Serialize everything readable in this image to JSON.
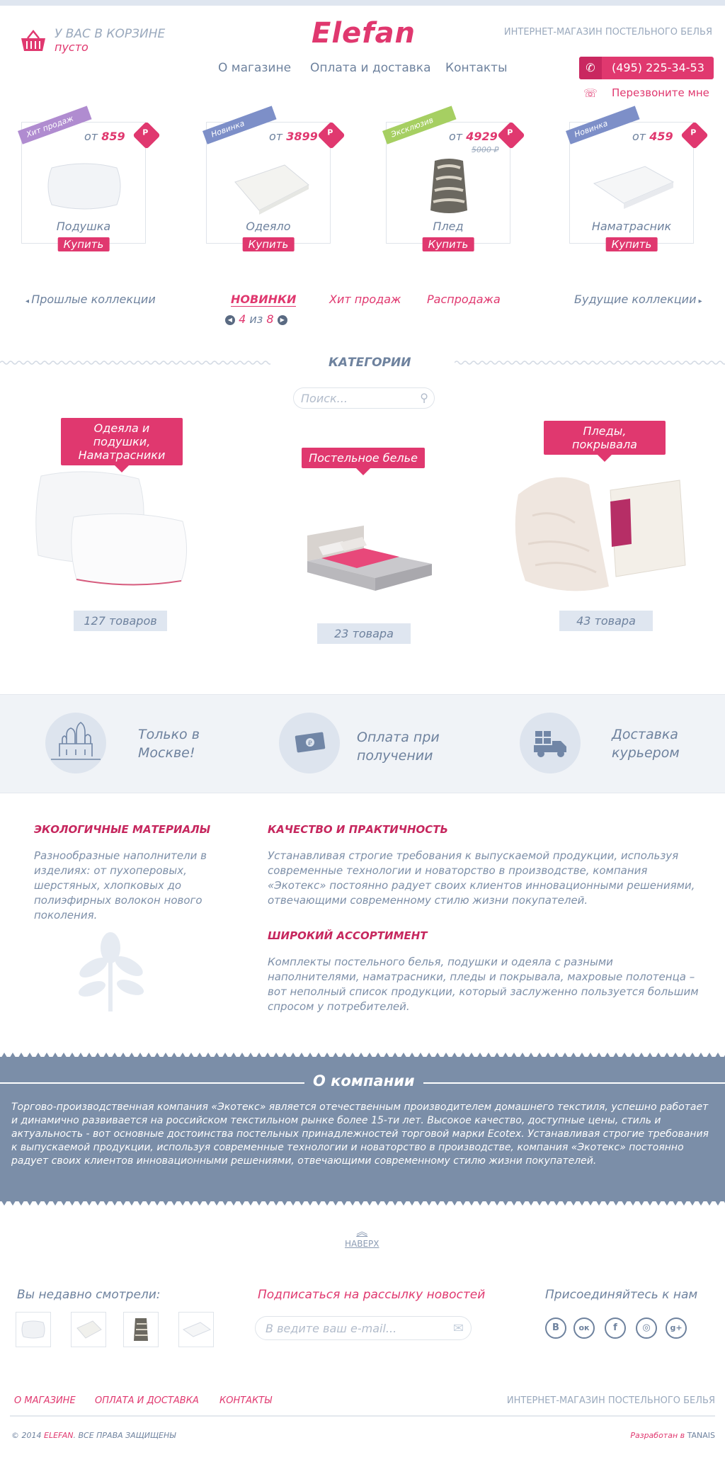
{
  "header": {
    "cart_line1": "У ВАС В КОРЗИНЕ",
    "cart_line2": "пусто",
    "logo": "Elefan",
    "tagline": "ИНТЕРНЕТ-МАГАЗИН ПОСТЕЛЬНОГО БЕЛЬЯ",
    "nav": [
      "О магазине",
      "Оплата и доставка",
      "Контакты"
    ],
    "phone": "(495) 225-34-53",
    "callback": "Перезвоните мне"
  },
  "products": [
    {
      "ribbon": "Хит продаж",
      "ribbon_color": "#b08cd0",
      "price_prefix": "от",
      "price": "859",
      "old_price": "",
      "currency": "Р",
      "name": "Подушка",
      "buy": "Купить"
    },
    {
      "ribbon": "Новинка",
      "ribbon_color": "#7d8fc8",
      "price_prefix": "от",
      "price": "3899",
      "old_price": "",
      "currency": "Р",
      "name": "Одеяло",
      "buy": "Купить"
    },
    {
      "ribbon": "Эксклюзив",
      "ribbon_color": "#a6cf62",
      "price_prefix": "от",
      "price": "4929",
      "old_price": "5000 ₽",
      "currency": "Р",
      "name": "Плед",
      "buy": "Купить"
    },
    {
      "ribbon": "Новинка",
      "ribbon_color": "#7d8fc8",
      "price_prefix": "от",
      "price": "459",
      "old_price": "",
      "currency": "Р",
      "name": "Наматрасник",
      "buy": "Купить"
    }
  ],
  "collections": {
    "prev": "Прошлые коллекции",
    "next": "Будущие коллекции",
    "tabs": [
      "НОВИНКИ",
      "Хит продаж",
      "Распродажа"
    ],
    "pager_current": "4",
    "pager_sep": "из",
    "pager_total": "8"
  },
  "categories": {
    "title": "КАТЕГОРИИ",
    "search_placeholder": "Поиск...",
    "items": [
      {
        "label": "Одеяла и подушки, Наматрасники",
        "count": "127 товаров"
      },
      {
        "label": "Постельное белье",
        "count": "23 товара"
      },
      {
        "label": "Пледы, покрывала",
        "count": "43 товара"
      }
    ]
  },
  "features": [
    {
      "text": "Только в Москве!",
      "icon": "kremlin-icon"
    },
    {
      "text": "Оплата при получении",
      "icon": "money-icon"
    },
    {
      "text": "Доставка курьером",
      "icon": "truck-icon"
    }
  ],
  "info": {
    "eco_title": "ЭКОЛОГИЧНЫЕ МАТЕРИАЛЫ",
    "eco_text": "Разнообразные наполнители в изделиях: от пухоперовых, шерстяных, хлопковых до полиэфирных волокон нового поколения.",
    "quality_title": "КАЧЕСТВО И ПРАКТИЧНОСТЬ",
    "quality_text": "Устанавливая строгие требования к выпускаемой продукции, используя современные технологии и новаторство в производстве, компания «Экотекс» постоянно радует своих клиентов инновационными решениями, отвечающими современному стилю жизни покупателей.",
    "range_title": "ШИРОКИЙ АССОРТИМЕНТ",
    "range_text": "Комплекты постельного белья, подушки и одеяла с разными наполнителями, наматрасники, пледы и покрывала, махровые полотенца – вот неполный список продукции, который заслуженно пользуется большим спросом у потребителей."
  },
  "about": {
    "title": "О компании",
    "text": "Торгово-производственная компания «Экотекс» является отечественным производителем домашнего текстиля, успешно работает и динамично развивается на российском текстильном рынке более 15-ти лет. Высокое качество, доступные цены, стиль и актуальность - вот основные достоинства постельных принадлежностей торговой марки Ecotex. Устанавливая строгие требования к выпускаемой продукции, используя современные технологии и новаторство в производстве, компания «Экотекс» постоянно радует своих клиентов инновационными решениями, отвечающими современному стилю жизни покупателей."
  },
  "up_label": "НАВЕРХ",
  "footer": {
    "recent_title": "Вы недавно смотрели:",
    "subscribe_title": "Подписаться на рассылку новостей",
    "email_placeholder": "В ведите ваш e-mail...",
    "social_title": "Присоединяйтесь к нам",
    "social": [
      "В",
      "ок",
      "f",
      "◎",
      "g+"
    ],
    "links": [
      "О МАГАЗИНЕ",
      "ОПЛАТА И ДОСТАВКА",
      "КОНТАКТЫ"
    ],
    "tagline": "ИНТЕРНЕТ-МАГАЗИН ПОСТЕЛЬНОГО БЕЛЬЯ",
    "copyright_prefix": "© 2014",
    "copyright_brand": "ELEFAN",
    "copyright_suffix": ". ВСЕ ПРАВА ЗАЩИЩЕНЫ",
    "dev_prefix": "Разработан в",
    "dev_name": "TANAIS"
  }
}
